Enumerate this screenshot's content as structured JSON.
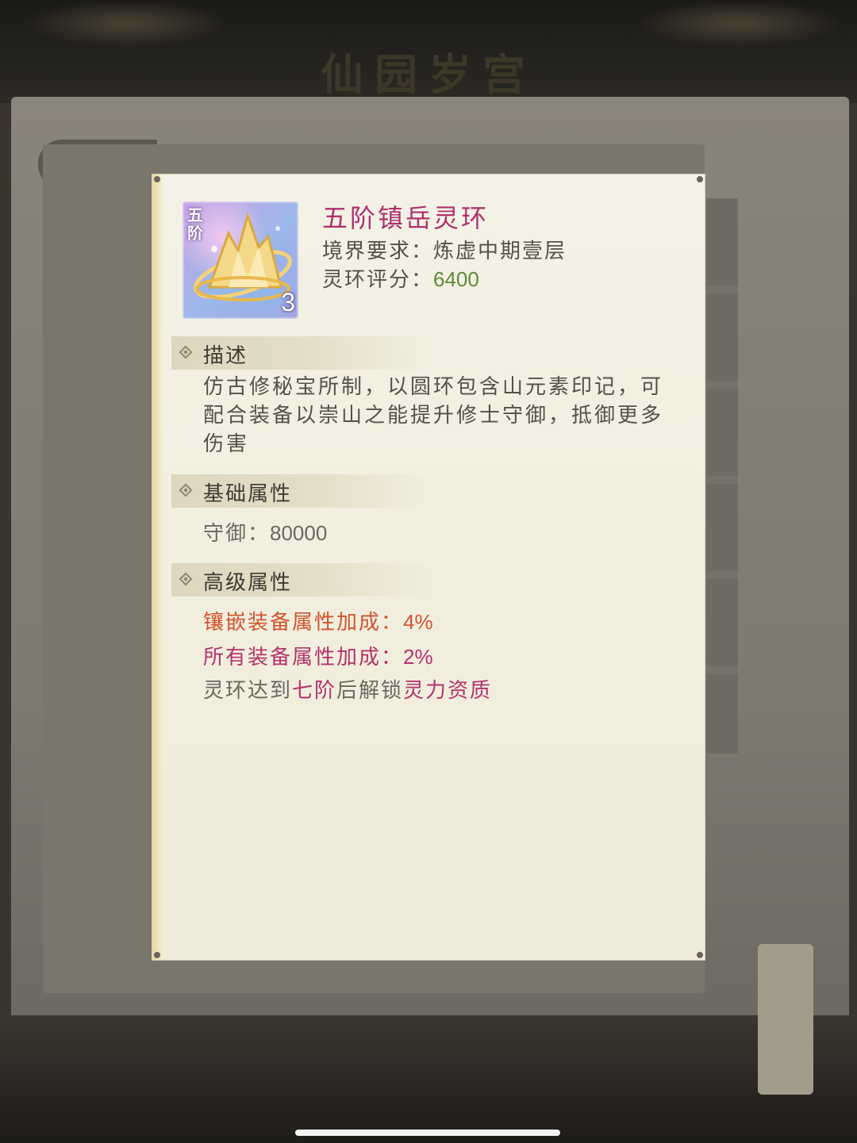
{
  "background": {
    "title": "仙园岁宫"
  },
  "item": {
    "icon_name": "mountain-ring-icon",
    "tier_badge": "五阶",
    "count": "3",
    "name": "五阶镇岳灵环",
    "requirement_label": "境界要求：",
    "requirement_value": "炼虚中期壹层",
    "score_label": "灵环评分：",
    "score_value": "6400"
  },
  "sections": {
    "description": {
      "header": "描述",
      "text": "仿古修秘宝所制，以圆环包含山元素印记，可配合装备以崇山之能提升修士守御，抵御更多伤害"
    },
    "base": {
      "header": "基础属性",
      "stat_label": "守御：",
      "stat_value": "80000"
    },
    "advanced": {
      "header": "高级属性",
      "line1_label": "镶嵌装备属性加成：",
      "line1_value": "4%",
      "line2_label": "所有装备属性加成：",
      "line2_value": "2%",
      "unlock_prefix": "灵环达到",
      "unlock_tier": "七阶",
      "unlock_middle": "后解锁",
      "unlock_target": "灵力资质"
    }
  },
  "colors": {
    "item_name": "#b0306e",
    "score": "#5e8b3a",
    "bonus_orange": "#d0542e",
    "bonus_pink": "#b5326c"
  }
}
